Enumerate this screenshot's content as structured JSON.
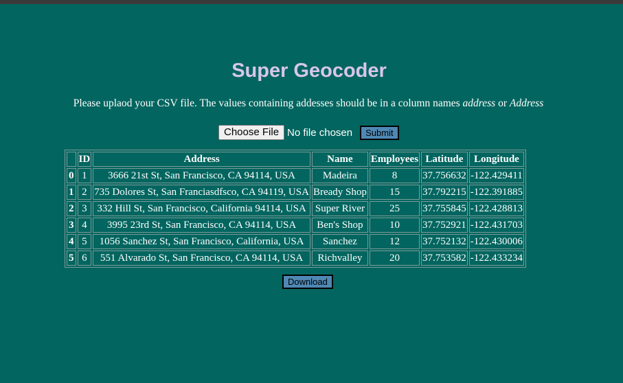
{
  "page": {
    "title": "Super Geocoder",
    "instructions_prefix": "Please uplaod your CSV file. The values containing addesses should be in a column names ",
    "instructions_em1": "address",
    "instructions_mid": " or ",
    "instructions_em2": "Address"
  },
  "upload": {
    "choose_label": "Choose File",
    "file_status": "No file chosen",
    "submit_label": "Submit"
  },
  "table": {
    "headers": [
      "",
      "ID",
      "Address",
      "Name",
      "Employees",
      "Latitude",
      "Longitude"
    ],
    "rows": [
      {
        "index": "0",
        "id": "1",
        "address": "3666 21st St, San Francisco, CA 94114, USA",
        "name": "Madeira",
        "employees": "8",
        "latitude": "37.756632",
        "longitude": "-122.429411"
      },
      {
        "index": "1",
        "id": "2",
        "address": "735 Dolores St, San Franciasdfsco, CA 94119, USA",
        "name": "Bready Shop",
        "employees": "15",
        "latitude": "37.792215",
        "longitude": "-122.391885"
      },
      {
        "index": "2",
        "id": "3",
        "address": "332 Hill St, San Francisco, California 94114, USA",
        "name": "Super River",
        "employees": "25",
        "latitude": "37.755845",
        "longitude": "-122.428813"
      },
      {
        "index": "3",
        "id": "4",
        "address": "3995 23rd St, San Francisco, CA 94114, USA",
        "name": "Ben's Shop",
        "employees": "10",
        "latitude": "37.752921",
        "longitude": "-122.431703"
      },
      {
        "index": "4",
        "id": "5",
        "address": "1056 Sanchez St, San Francisco, California, USA",
        "name": "Sanchez",
        "employees": "12",
        "latitude": "37.752132",
        "longitude": "-122.430006"
      },
      {
        "index": "5",
        "id": "6",
        "address": "551 Alvarado St, San Francisco, CA 94114, USA",
        "name": "Richvalley",
        "employees": "20",
        "latitude": "37.753582",
        "longitude": "-122.433234"
      }
    ]
  },
  "download": {
    "label": "Download"
  },
  "colors": {
    "background": "#03655f",
    "title": "#d8c6ec",
    "button": "#4f88b4"
  }
}
